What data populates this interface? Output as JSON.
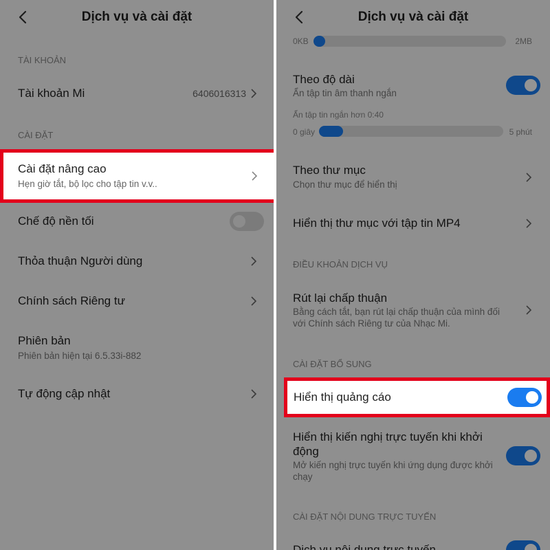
{
  "left": {
    "title": "Dịch vụ và cài đặt",
    "section_account": "TÀI KHOẢN",
    "account_label": "Tài khoản Mi",
    "account_value": "6406016313",
    "section_settings": "CÀI ĐẶT",
    "advanced_title": "Cài đặt nâng cao",
    "advanced_sub": "Hẹn giờ tắt, bộ lọc cho tập tin v.v..",
    "dark_mode": "Chế độ nền tối",
    "user_agreement": "Thỏa thuận Người dùng",
    "privacy_policy": "Chính sách Riêng tư",
    "version_title": "Phiên bản",
    "version_sub": "Phiên bản hiện tại 6.5.33i-882",
    "auto_update": "Tự động cập nhật"
  },
  "right": {
    "title": "Dịch vụ và cài đặt",
    "size_min": "0KB",
    "size_max": "2MB",
    "size_fill": 0.05,
    "length_title": "Theo độ dài",
    "length_sub": "Ẩn tập tin âm thanh ngắn",
    "hide_shorter": "Ẩn tập tin ngắn hơn 0:40",
    "len_min": "0 giây",
    "len_max": "5 phút",
    "len_fill": 0.13,
    "folder_title": "Theo thư mục",
    "folder_sub": "Chọn thư mục để hiển thị",
    "mp4_folder": "Hiển thị thư mục với tập tin MP4",
    "section_terms": "ĐIỀU KHOẢN DỊCH VỤ",
    "withdraw_title": "Rút lại chấp thuận",
    "withdraw_sub1": "Bằng cách tắt, bạn rút lại chấp thuận của mình đối",
    "withdraw_sub2": "với Chính sách Riêng tư của Nhạc Mi.",
    "section_extra": "CÀI ĐẶT BỔ SUNG",
    "show_ads": "Hiển thị quảng cáo",
    "online_rec_title1": "Hiển thị kiến nghị trực tuyến khi khởi",
    "online_rec_title2": "động",
    "online_rec_sub1": "Mở kiến nghị trực tuyến khi ứng dụng được khởi",
    "online_rec_sub2": "chạy",
    "section_online": "CÀI ĐẶT NỘI DUNG TRỰC TUYẾN",
    "online_service": "Dịch vụ nội dung trực tuyến"
  },
  "colors": {
    "accent": "#1a7cf0",
    "highlight_border": "#e3001b"
  }
}
